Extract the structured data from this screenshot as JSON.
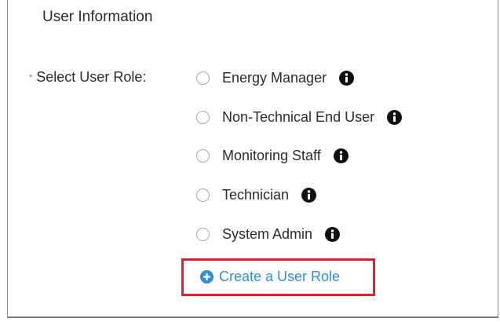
{
  "section": {
    "title": "User Information"
  },
  "role_field": {
    "required_marker": "*",
    "label": "Select User Role:",
    "options": [
      {
        "label": "Energy Manager",
        "selected": false
      },
      {
        "label": "Non-Technical End User",
        "selected": false
      },
      {
        "label": "Monitoring Staff",
        "selected": false
      },
      {
        "label": "Technician",
        "selected": false
      },
      {
        "label": "System Admin",
        "selected": false
      }
    ]
  },
  "create_role": {
    "label": "Create a User Role",
    "icon": "plus-circle-icon",
    "highlight_color": "#e0202e",
    "link_color": "#2f8fd8"
  },
  "icons": {
    "info": "info-circle-icon"
  }
}
